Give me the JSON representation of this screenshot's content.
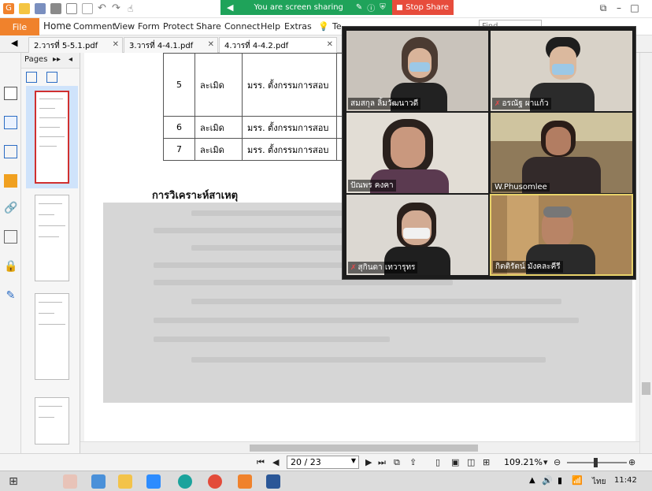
{
  "share_bar": {
    "status_text": "You are screen sharing",
    "stop_label": "Stop Share",
    "color": "#1fa35a",
    "stop_color": "#e74c3c"
  },
  "menubar": {
    "file_label": "File",
    "items": [
      "Home",
      "Comment",
      "View",
      "Form",
      "Protect",
      "Share",
      "Connect",
      "Help",
      "Extras"
    ],
    "tell_me": "Te",
    "find_placeholder": "Find"
  },
  "tabs": [
    {
      "label": "2.วารที่ 5-5.1.pdf"
    },
    {
      "label": "3.วารที่ 4-4.1.pdf"
    },
    {
      "label": "4.วารที่ 4-4.2.pdf",
      "active": true
    }
  ],
  "pages_panel": {
    "title": "Pages"
  },
  "document": {
    "table_rows": [
      {
        "no": "5",
        "status": "ละเมิด",
        "who": "มรร. ตั้งกรรมการสอบ",
        "tail": "ก"
      },
      {
        "no": "6",
        "status": "ละเมิด",
        "who": "มรร. ตั้งกรรมการสอบ",
        "tail": "ทุ"
      },
      {
        "no": "7",
        "status": "ละเมิด",
        "who": "มรร. ตั้งกรรมการสอบ",
        "tail": "ทุ"
      }
    ],
    "heading": "การวิเคราะห์สาเหตุ"
  },
  "zoom": {
    "participants": [
      {
        "name": "สมสกุล ลิ้มวัฒนาวดี",
        "muted": false
      },
      {
        "name": "อรณัฐ ผาแก้ว",
        "muted": true
      },
      {
        "name": "ปัณพร คงคา",
        "muted": false
      },
      {
        "name": "W.Phusomlee",
        "muted": false
      },
      {
        "name": "สุกินดา เทวารุทร",
        "muted": true
      },
      {
        "name": "กิตติรัตน์ มังคละคีรี",
        "muted": false,
        "active": true
      }
    ]
  },
  "statusbar": {
    "page_value": "20 / 23",
    "zoom_value": "109.21%"
  },
  "taskbar": {
    "lang": "ไทย",
    "time": "11:42"
  }
}
